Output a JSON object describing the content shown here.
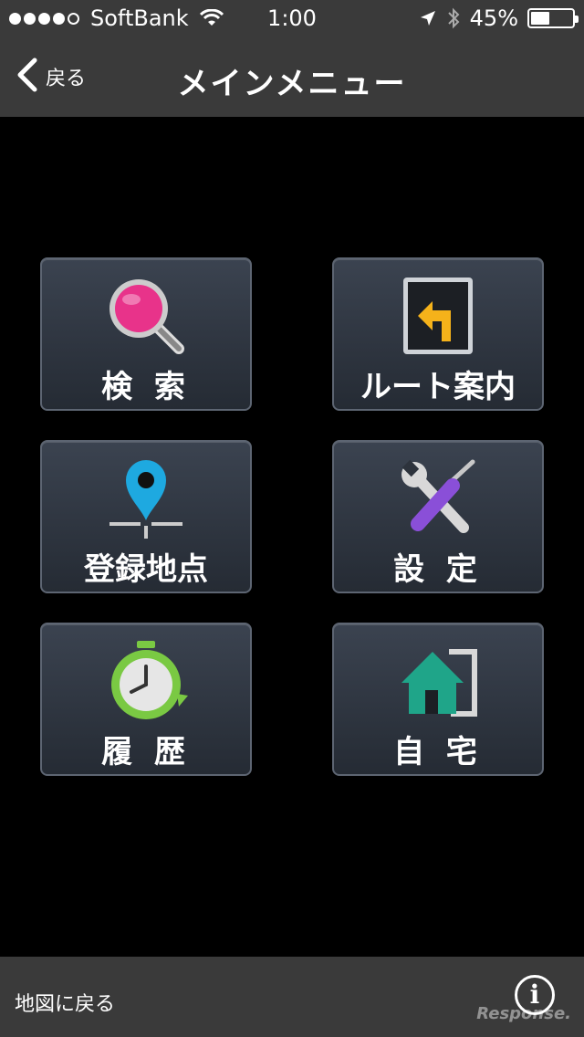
{
  "status_bar": {
    "carrier": "SoftBank",
    "signal_bars_filled": 4,
    "signal_bars_total": 5,
    "time": "1:00",
    "battery_percent_text": "45%",
    "battery_level": 0.45
  },
  "nav": {
    "back_label": "戻る",
    "title": "メインメニュー"
  },
  "menu": {
    "search": "検 索",
    "route": "ルート案内",
    "registered": "登録地点",
    "settings": "設 定",
    "history": "履 歴",
    "home": "自 宅"
  },
  "bottom": {
    "back_to_map": "地図に戻る",
    "info_symbol": "i",
    "watermark": "Response."
  },
  "colors": {
    "search_lens": "#e8338a",
    "route_arrow": "#f5b21a",
    "pin": "#1ea9e0",
    "settings_driver": "#8a4fd8",
    "history_ring": "#7ac943",
    "home": "#1fa589"
  }
}
